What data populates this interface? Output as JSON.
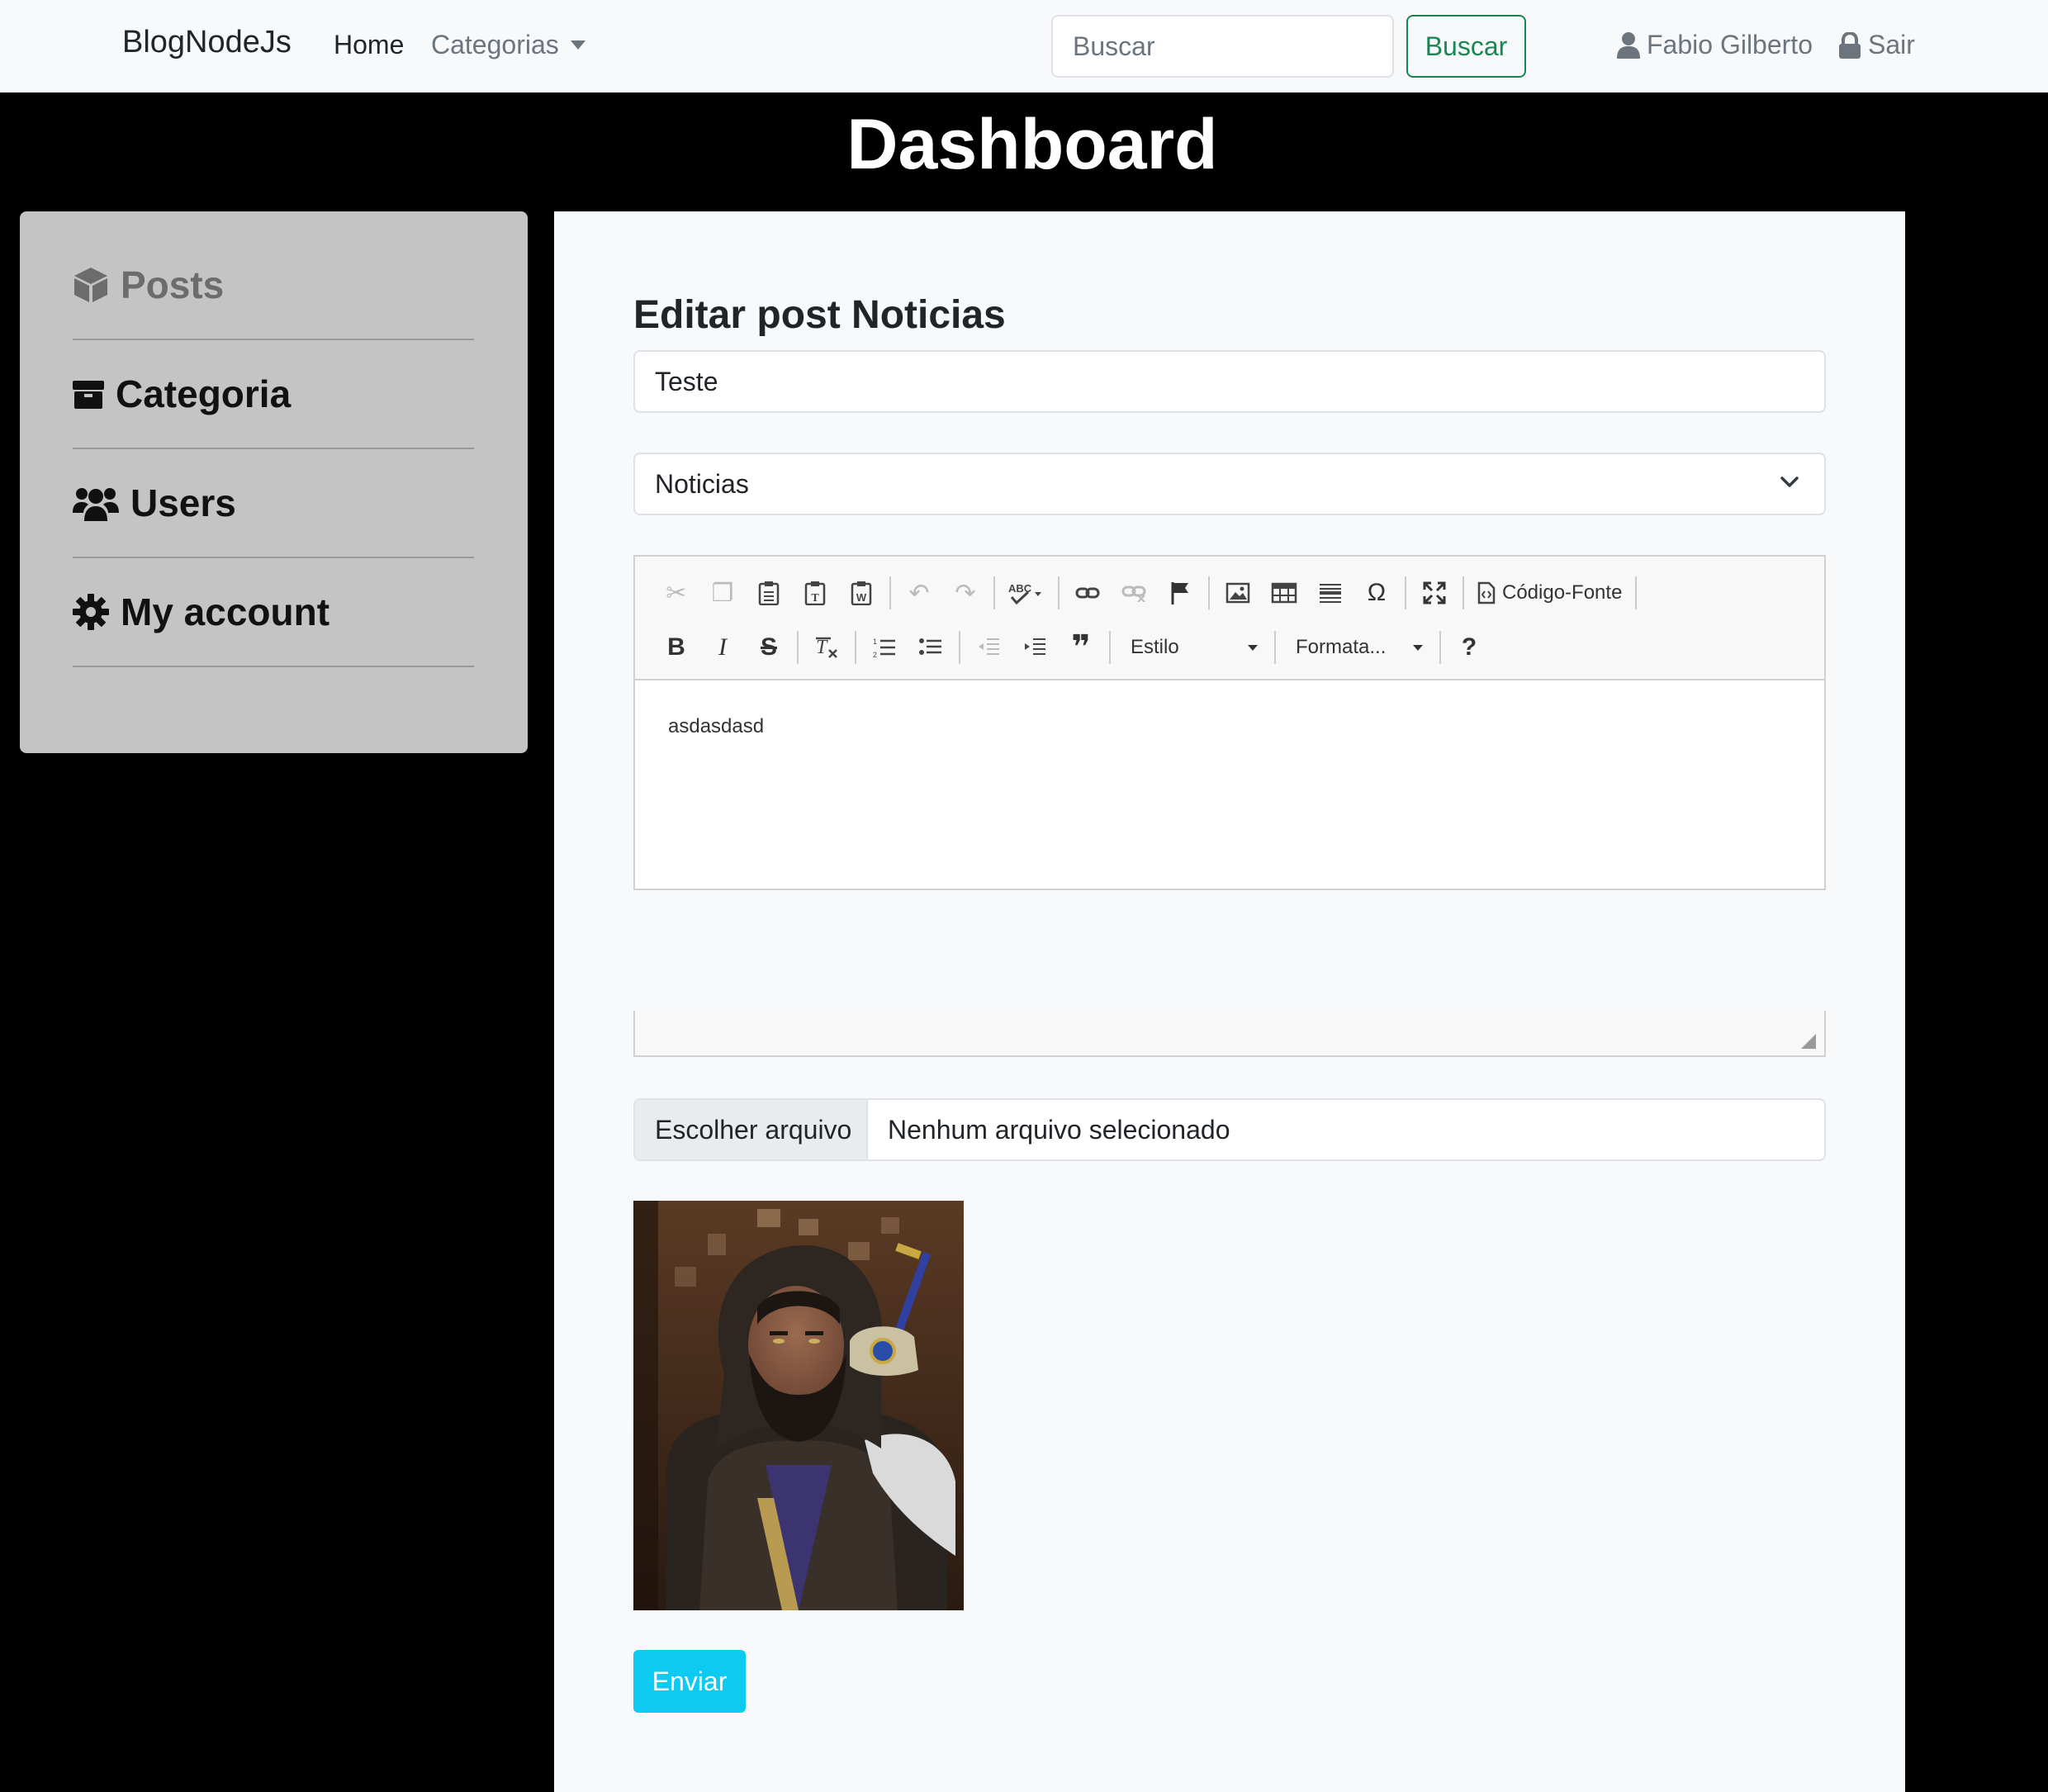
{
  "navbar": {
    "brand": "BlogNodeJs",
    "home": "Home",
    "categories": "Categorias",
    "search_placeholder": "Buscar",
    "search_button": "Buscar",
    "user": "Fabio Gilberto",
    "logout": "Sair"
  },
  "header": {
    "title": "Dashboard"
  },
  "sidebar": {
    "items": [
      {
        "label": "Posts",
        "icon": "cube-icon"
      },
      {
        "label": "Categoria",
        "icon": "box-icon"
      },
      {
        "label": "Users",
        "icon": "users-icon"
      },
      {
        "label": "My account",
        "icon": "gear-icon"
      }
    ]
  },
  "form": {
    "title": "Editar post Noticias",
    "post_title_value": "Teste",
    "category_selected": "Noticias",
    "editor": {
      "toolbar": {
        "source_label": "Código-Fonte",
        "style_label": "Estilo",
        "format_label": "Formata..."
      },
      "content": "asdasdasd"
    },
    "file": {
      "button_label": "Escolher arquivo",
      "status": "Nenhum arquivo selecionado"
    },
    "submit_label": "Enviar"
  },
  "colors": {
    "navbar_bg": "#f8f9fa",
    "page_bg": "#000000",
    "sidebar_bg": "#c4c4c4",
    "search_accent": "#198754",
    "submit_bg": "#0dcaf0"
  }
}
